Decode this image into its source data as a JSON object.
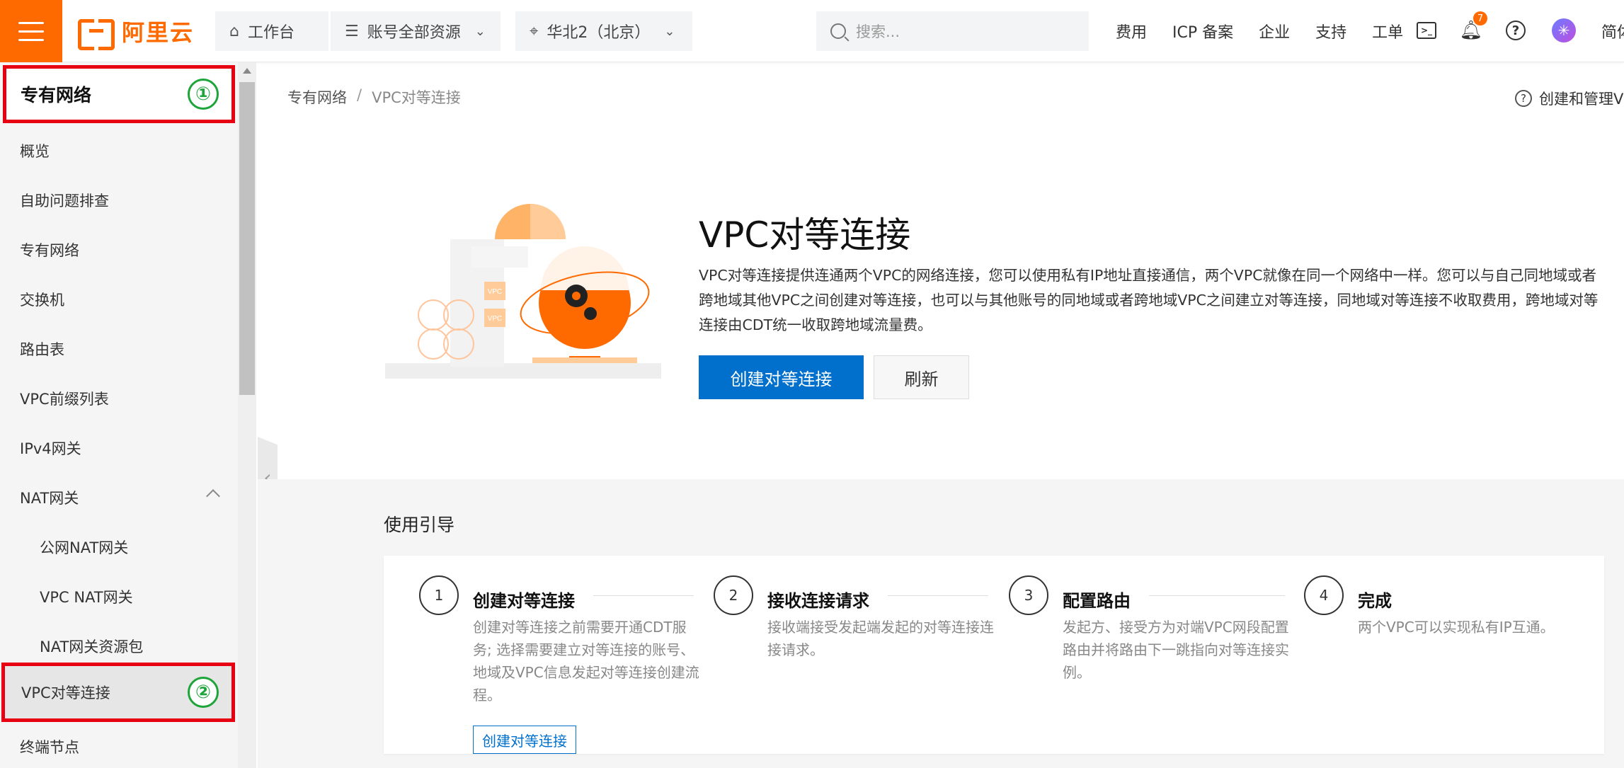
{
  "topbar": {
    "logo_text": "阿里云",
    "workbench": "工作台",
    "resource_group": "账号全部资源",
    "region": "华北2（北京）",
    "search_placeholder": "搜索...",
    "links": [
      "费用",
      "ICP 备案",
      "企业",
      "支持",
      "工单"
    ],
    "notification_count": "7",
    "language": "简体"
  },
  "sidebar": {
    "title": "专有网络",
    "title_marker": "①",
    "items": [
      {
        "label": "概览"
      },
      {
        "label": "自助问题排查"
      },
      {
        "label": "专有网络"
      },
      {
        "label": "交换机"
      },
      {
        "label": "路由表"
      },
      {
        "label": "VPC前缀列表"
      },
      {
        "label": "IPv4网关"
      },
      {
        "label": "NAT网关"
      },
      {
        "label": "公网NAT网关"
      },
      {
        "label": "VPC NAT网关"
      },
      {
        "label": "NAT网关资源包"
      },
      {
        "label": "VPC对等连接"
      },
      {
        "label": "终端节点"
      }
    ],
    "active_marker": "②"
  },
  "breadcrumb": {
    "root": "专有网络",
    "separator": "/",
    "current": "VPC对等连接"
  },
  "help_link": "创建和管理VPC",
  "hero": {
    "title": "VPC对等连接",
    "description": "VPC对等连接提供连通两个VPC的网络连接，您可以使用私有IP地址直接通信，两个VPC就像在同一个网络中一样。您可以与自己同地域或者跨地域其他VPC之间创建对等连接，也可以与其他账号的同地域或者跨地域VPC之间建立对等连接，同地域对等连接不收取费用，跨地域对等连接由CDT统一收取跨地域流量费。",
    "create_button": "创建对等连接",
    "refresh_button": "刷新",
    "illustration_label": "VPC"
  },
  "guide": {
    "title": "使用引导",
    "steps": [
      {
        "num": "1",
        "title": "创建对等连接",
        "desc": "创建对等连接之前需要开通CDT服务; 选择需要建立对等连接的账号、地域及VPC信息发起对等连接创建流程。",
        "link": "创建对等连接"
      },
      {
        "num": "2",
        "title": "接收连接请求",
        "desc": "接收端接受发起端发起的对等连接连接请求。"
      },
      {
        "num": "3",
        "title": "配置路由",
        "desc": "发起方、接受方为对端VPC网段配置路由并将路由下一跳指向对等连接实例。"
      },
      {
        "num": "4",
        "title": "完成",
        "desc": "两个VPC可以实现私有IP互通。"
      }
    ]
  },
  "colors": {
    "brand": "#ff6a00",
    "primary": "#0070cc",
    "highlight": "#e60012",
    "marker": "#1ea53a"
  }
}
